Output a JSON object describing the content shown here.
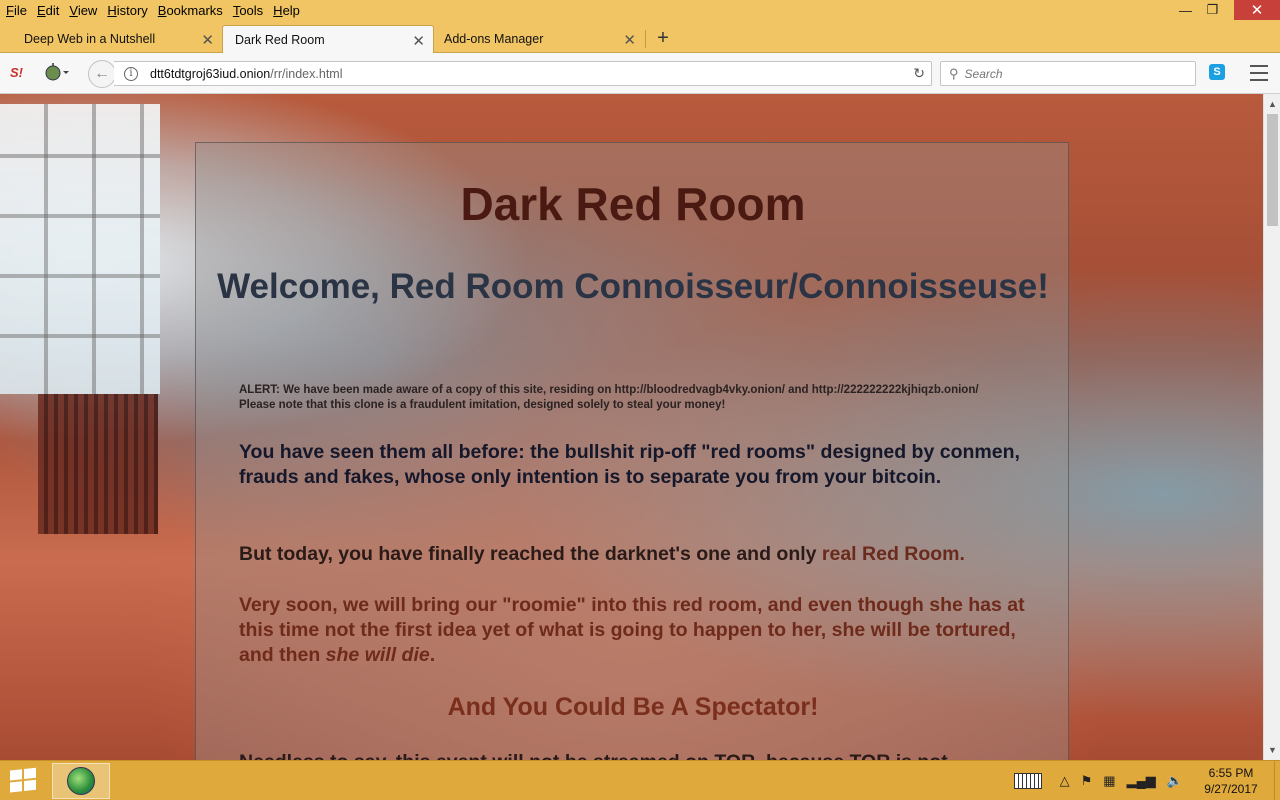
{
  "menubar": {
    "items": [
      {
        "label": "File",
        "key": "F",
        "rest": "ile"
      },
      {
        "label": "Edit",
        "key": "E",
        "rest": "dit"
      },
      {
        "label": "View",
        "key": "V",
        "rest": "iew"
      },
      {
        "label": "History",
        "key": "H",
        "rest": "istory"
      },
      {
        "label": "Bookmarks",
        "key": "B",
        "rest": "ookmarks"
      },
      {
        "label": "Tools",
        "key": "T",
        "rest": "ools"
      },
      {
        "label": "Help",
        "key": "H",
        "rest": "elp"
      }
    ],
    "minimize_icon": "minimize-icon",
    "restore_icon": "restore-icon",
    "close_icon": "close-icon"
  },
  "tabs": [
    {
      "label": "Deep Web in a Nutshell",
      "active": false
    },
    {
      "label": "Dark Red Room",
      "active": true
    },
    {
      "label": "Add-ons Manager",
      "active": false
    }
  ],
  "navbar": {
    "url_host": "dtt6tdtgroj63iud.onion",
    "url_path": "/rr/index.html",
    "search_placeholder": "Search",
    "skype_label": "S"
  },
  "page": {
    "title": "Dark Red Room",
    "welcome": "Welcome, Red Room Connoisseur/Connoisseuse!",
    "alert_label": "ALERT:",
    "alert_text": " We have been made aware of a copy of this site, residing on http://bloodredvagb4vky.onion/ and http://222222222kjhiqzb.onion/",
    "alert_text2": "Please note that this clone is a fraudulent imitation, designed solely to steal your money!",
    "para1": "You have seen them all before: the bullshit rip-off \"red rooms\" designed by conmen, frauds and fakes, whose only intention is to separate you from your bitcoin.",
    "para2_a": "But today, you have finally reached the darknet's one and only ",
    "para2_b": "real Red Room.",
    "para3_a": "Very soon, we will bring our \"roomie\" into this red room, and even though she has at this time not the first idea yet of what is going to happen to her, she will be tortured, and then ",
    "para3_em": "she will die",
    "para3_end": ".",
    "spectator": "And You Could Be A Spectator!",
    "para4": "Needless to say, this event will not be streamed on TOR, because TOR is not"
  },
  "taskbar": {
    "time": "6:55 PM",
    "date": "9/27/2017"
  }
}
